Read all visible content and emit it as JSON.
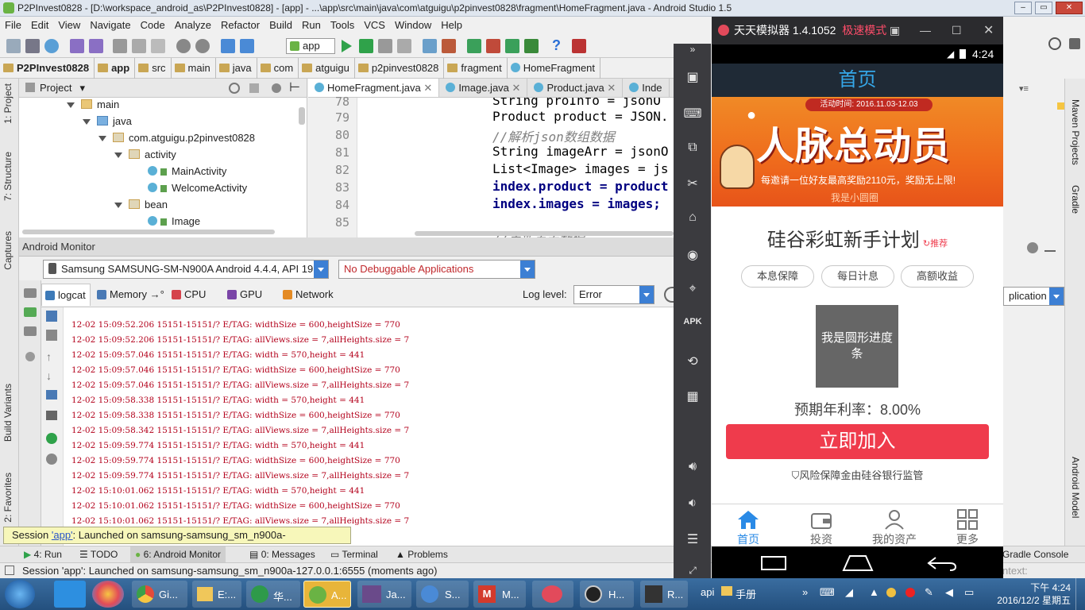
{
  "ide": {
    "window_title": "P2PInvest0828 - [D:\\workspace_android_as\\P2PInvest0828] - [app] - ...\\app\\src\\main\\java\\com\\atguigu\\p2pinvest0828\\fragment\\HomeFragment.java - Android Studio 1.5",
    "menu": [
      "File",
      "Edit",
      "View",
      "Navigate",
      "Code",
      "Analyze",
      "Refactor",
      "Build",
      "Run",
      "Tools",
      "VCS",
      "Window",
      "Help"
    ],
    "run_config": "app",
    "breadcrumb": [
      "P2PInvest0828",
      "app",
      "src",
      "main",
      "java",
      "com",
      "atguigu",
      "p2pinvest0828",
      "fragment",
      "HomeFragment"
    ],
    "left_tabs": [
      "1: Project",
      "7: Structure",
      "Captures",
      "Build Variants",
      "2: Favorites"
    ],
    "right_tabs": [
      "Maven Projects",
      "Gradle",
      "Android Model"
    ],
    "project_panel": {
      "title": "Project",
      "tree": [
        {
          "label": "main",
          "kind": "folder",
          "depth": 0
        },
        {
          "label": "java",
          "kind": "folder",
          "depth": 1
        },
        {
          "label": "com.atguigu.p2pinvest0828",
          "kind": "package",
          "depth": 2
        },
        {
          "label": "activity",
          "kind": "package",
          "depth": 3
        },
        {
          "label": "MainActivity",
          "kind": "class",
          "depth": 4
        },
        {
          "label": "WelcomeActivity",
          "kind": "class",
          "depth": 4
        },
        {
          "label": "bean",
          "kind": "package",
          "depth": 3
        },
        {
          "label": "Image",
          "kind": "class",
          "depth": 4
        }
      ]
    },
    "editor": {
      "tabs": [
        "HomeFragment.java",
        "Image.java",
        "Product.java",
        "Inde"
      ],
      "lines": [
        {
          "num": "78",
          "text": "String proInfo = jsonO"
        },
        {
          "num": "79",
          "text": "Product product = JSON."
        },
        {
          "num": "80",
          "text": "//解析json数组数据"
        },
        {
          "num": "81",
          "text": "String imageArr = jsonO"
        },
        {
          "num": "82",
          "text": "List<Image> images = js"
        },
        {
          "num": "83",
          "text": "index.product = product"
        },
        {
          "num": "84",
          "text": "index.images = images;"
        },
        {
          "num": "85",
          "text": ""
        },
        {
          "num": "86",
          "text": "//更新页面数据"
        }
      ],
      "overflow_right": ");"
    },
    "monitor": {
      "title": "Android Monitor",
      "device": "Samsung SAMSUNG-SM-N900A Android 4.4.4, API 19",
      "process": "No Debuggable Applications",
      "tabs": [
        "logcat",
        "Memory",
        "CPU",
        "GPU",
        "Network"
      ],
      "log_level_label": "Log level:",
      "log_level": "Error",
      "filter": "plication",
      "log_lines": [
        "12-02 15:09:52.206 15151-15151/? E/TAG: widthSize = 600,heightSize = 770",
        "12-02 15:09:52.206 15151-15151/? E/TAG: allViews.size = 7,allHeights.size = 7",
        "12-02 15:09:57.046 15151-15151/? E/TAG: width = 570,height = 441",
        "12-02 15:09:57.046 15151-15151/? E/TAG: widthSize = 600,heightSize = 770",
        "12-02 15:09:57.046 15151-15151/? E/TAG: allViews.size = 7,allHeights.size = 7",
        "12-02 15:09:58.338 15151-15151/? E/TAG: width = 570,height = 441",
        "12-02 15:09:58.338 15151-15151/? E/TAG: widthSize = 600,heightSize = 770",
        "12-02 15:09:58.342 15151-15151/? E/TAG: allViews.size = 7,allHeights.size = 7",
        "12-02 15:09:59.774 15151-15151/? E/TAG: width = 570,height = 441",
        "12-02 15:09:59.774 15151-15151/? E/TAG: widthSize = 600,heightSize = 770",
        "12-02 15:09:59.774 15151-15151/? E/TAG: allViews.size = 7,allHeights.size = 7",
        "12-02 15:10:01.062 15151-15151/? E/TAG: width = 570,height = 441",
        "12-02 15:10:01.062 15151-15151/? E/TAG: widthSize = 600,heightSize = 770",
        "12-02 15:10:01.062 15151-15151/? E/TAG: allViews.size = 7,allHeights.size = 7"
      ]
    },
    "session_tip": {
      "prefix": "Session ",
      "link": "'app'",
      "suffix": ": Launched on samsung-samsung_sm_n900a-127.0.0.1:6555"
    },
    "bottom_tabs": [
      "4: Run",
      "TODO",
      "6: Android Monitor",
      "0: Messages",
      "Terminal",
      "Problems",
      "Gradle Console"
    ],
    "status": "Session 'app': Launched on samsung-samsung_sm_n900a-127.0.0.1:6555 (moments ago)",
    "status_right": "ntext:"
  },
  "emulator": {
    "title": "天天模拟器 1.4.1052",
    "mode": "极速模式",
    "time": "4:24",
    "page_title": "首页",
    "banner": {
      "date": "活动时间: 2016.11.03-12.03",
      "headline": "人脉总动员",
      "sub": "每邀请一位好友最高奖励2110元，奖励无上限!",
      "tag": "我是小圆圈"
    },
    "plan_title": "硅谷彩虹新手计划",
    "plan_badge": "推荐",
    "pills": [
      "本息保障",
      "每日计息",
      "高额收益"
    ],
    "progress_text": "我是圆形进度条",
    "rate": "预期年利率：8.00%",
    "join_button": "立即加入",
    "guarantee": "风险保障金由硅谷银行监管",
    "nav": [
      "首页",
      "投资",
      "我的资产",
      "更多"
    ],
    "accent": "#ef3b4c",
    "header_color": "#35a7e8"
  },
  "taskbar": {
    "apps": [
      "Gi...",
      "E:...",
      "华...",
      "A...",
      "Ja...",
      "S...",
      "M...",
      "H...",
      "R..."
    ],
    "tray_text": "api",
    "folder": "手册",
    "clock_time": "下午 4:24",
    "clock_date": "2016/12/2 星期五"
  }
}
